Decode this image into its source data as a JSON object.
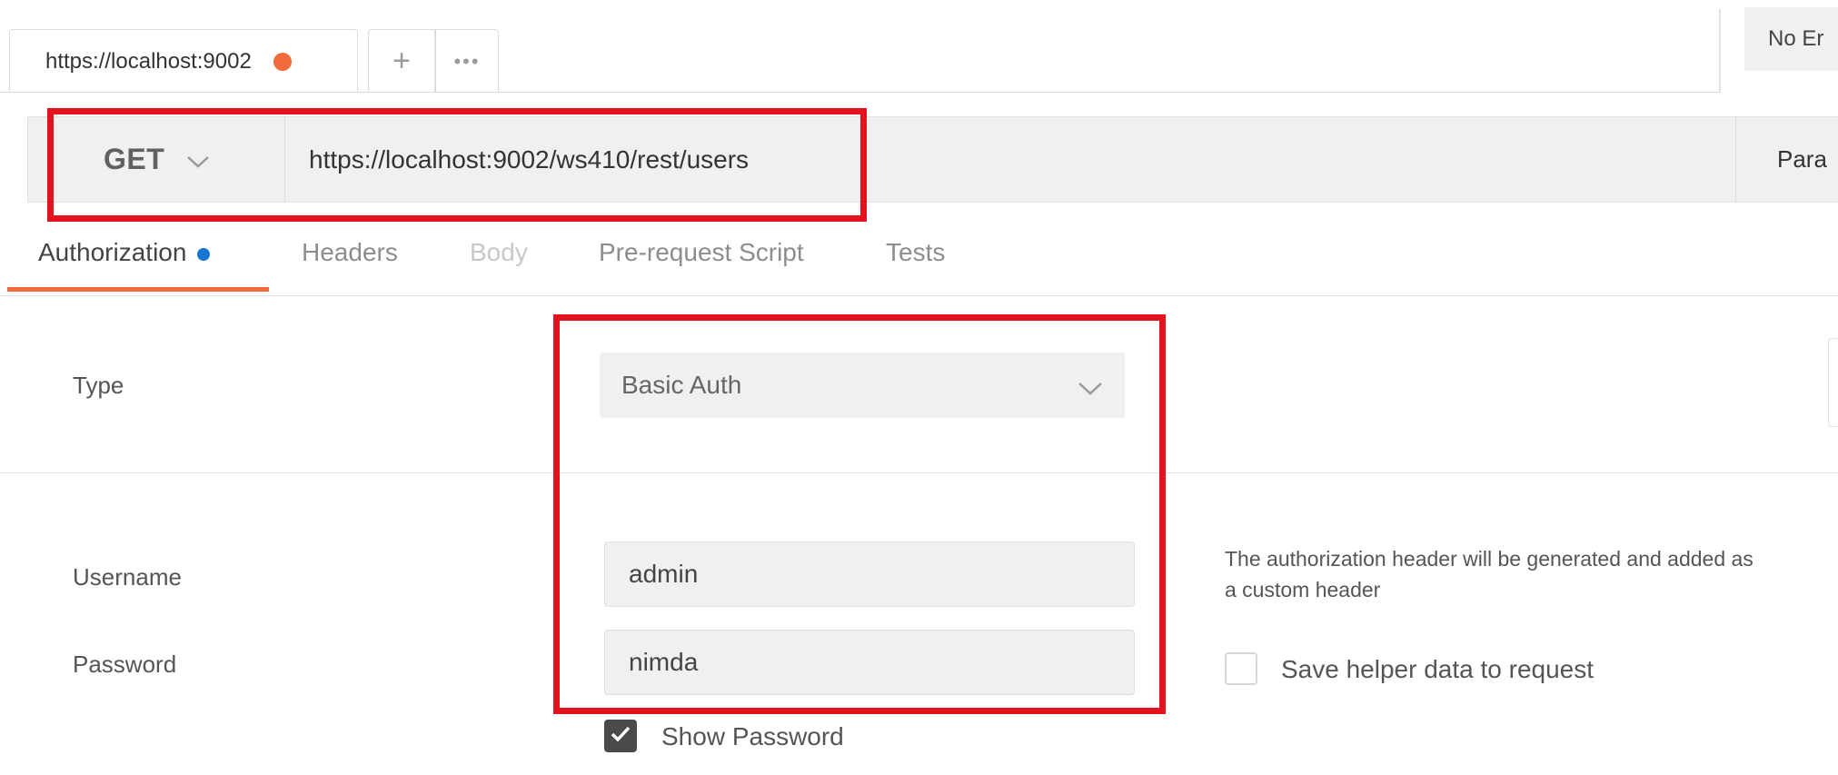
{
  "tabs": [
    {
      "title": "https://localhost:9002",
      "unsaved": true
    }
  ],
  "tab_actions": {
    "add": "+",
    "more": "•••"
  },
  "environment": {
    "label": "No Er"
  },
  "request": {
    "method": "GET",
    "url": "https://localhost:9002/ws410/rest/users",
    "params_label": "Para"
  },
  "subtabs": [
    {
      "label": "Authorization",
      "active": true
    },
    {
      "label": "Headers"
    },
    {
      "label": "Body",
      "disabled": true
    },
    {
      "label": "Pre-request Script"
    },
    {
      "label": "Tests"
    }
  ],
  "auth": {
    "type_label": "Type",
    "type_value": "Basic Auth",
    "username_label": "Username",
    "username_value": "admin",
    "password_label": "Password",
    "password_value": "nimda",
    "show_password_label": "Show Password",
    "show_password_checked": true,
    "help_text": "The authorization header will be generated and added as a custom header",
    "save_helper_label": "Save helper data to request",
    "save_helper_checked": false
  },
  "colors": {
    "accent_orange": "#f26b3a",
    "auth_dot_blue": "#1876d3",
    "annotation_red": "#e4121c"
  }
}
